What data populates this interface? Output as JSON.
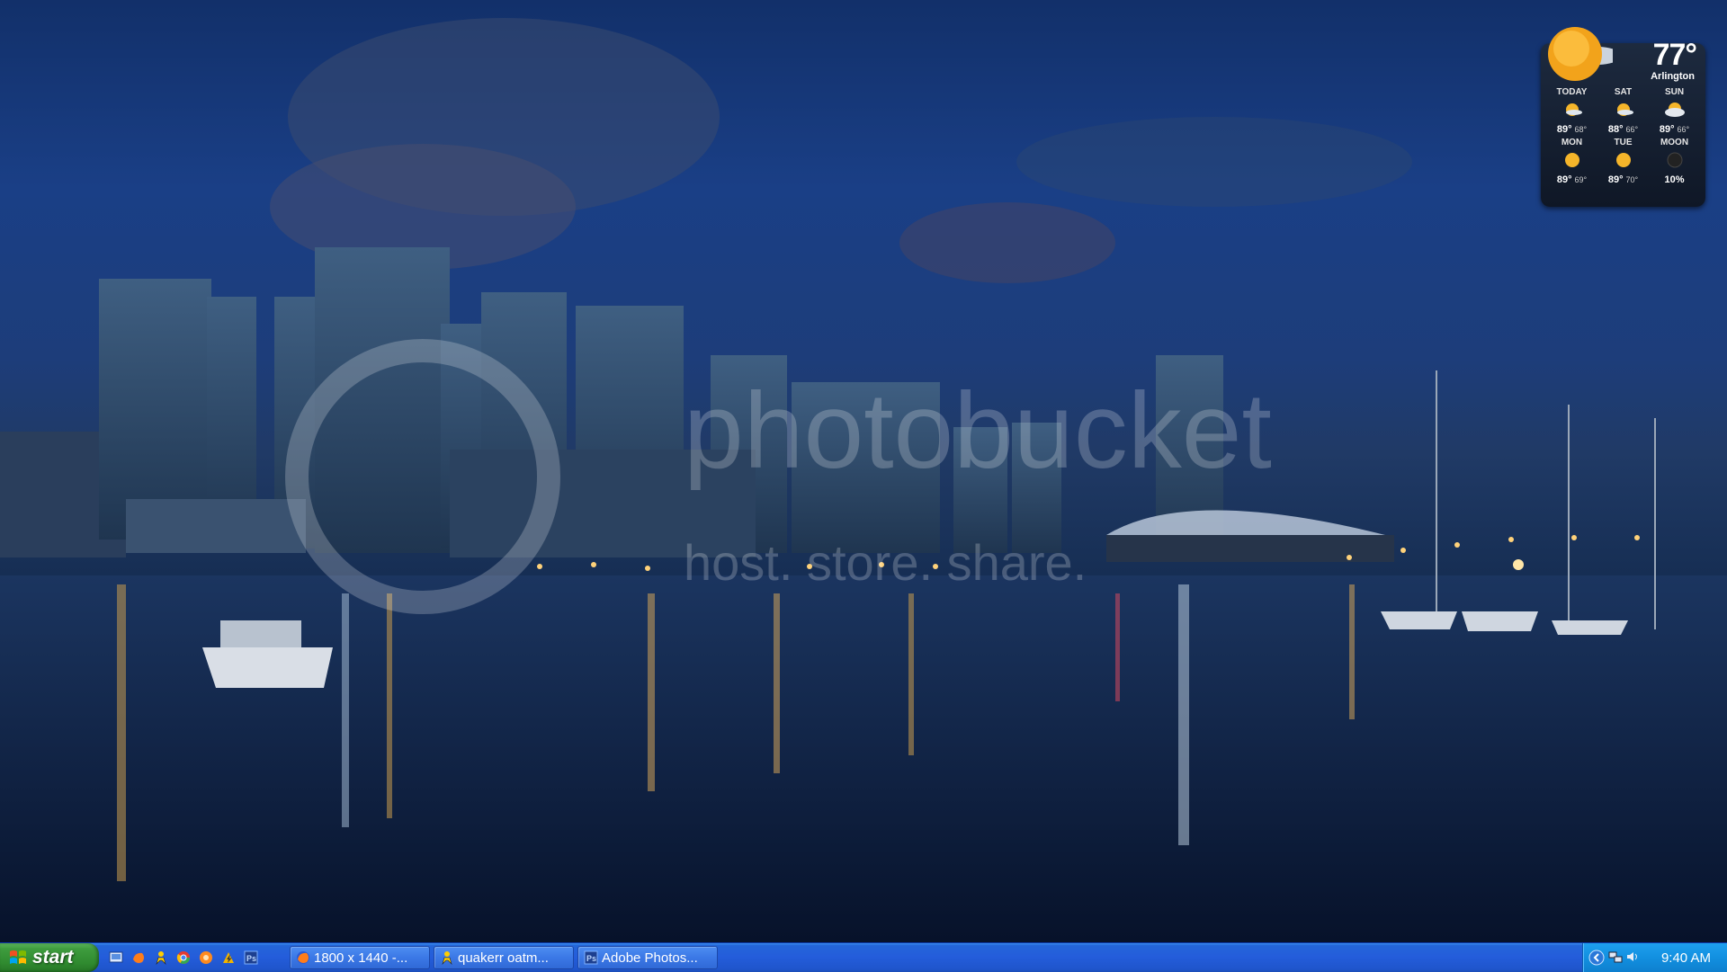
{
  "wallpaper": {
    "watermark_lines": [
      "photobucket",
      "host. store. share."
    ]
  },
  "weather": {
    "current_temp": "77°",
    "city": "Arlington",
    "forecast": [
      {
        "day": "TODAY",
        "high": "89°",
        "low": "68°",
        "icon": "partly-sunny-icon"
      },
      {
        "day": "SAT",
        "high": "88°",
        "low": "66°",
        "icon": "partly-sunny-icon"
      },
      {
        "day": "SUN",
        "high": "89°",
        "low": "66°",
        "icon": "partly-cloudy-icon"
      },
      {
        "day": "MON",
        "high": "89°",
        "low": "69°",
        "icon": "sunny-icon"
      },
      {
        "day": "TUE",
        "high": "89°",
        "low": "70°",
        "icon": "sunny-icon"
      },
      {
        "day": "MOON",
        "high": "10%",
        "low": "",
        "icon": "moon-icon"
      }
    ]
  },
  "taskbar": {
    "start_label": "start",
    "quicklaunch": [
      "show-desktop-icon",
      "firefox-icon",
      "aim-icon",
      "chrome-icon",
      "media-icon",
      "winamp-icon",
      "photoshop-icon"
    ],
    "tasks": [
      {
        "label": "1800 x 1440 -...",
        "icon": "firefox-icon"
      },
      {
        "label": "quakerr oatm...",
        "icon": "aim-icon"
      },
      {
        "label": "Adobe Photos...",
        "icon": "photoshop-icon"
      }
    ],
    "tray_icons": [
      "network-icon",
      "volume-icon"
    ],
    "clock": "9:40 AM"
  },
  "colors": {
    "taskbar_blue": "#245ddb",
    "start_green": "#3e9c3e",
    "tray_blue": "#1290e0"
  }
}
